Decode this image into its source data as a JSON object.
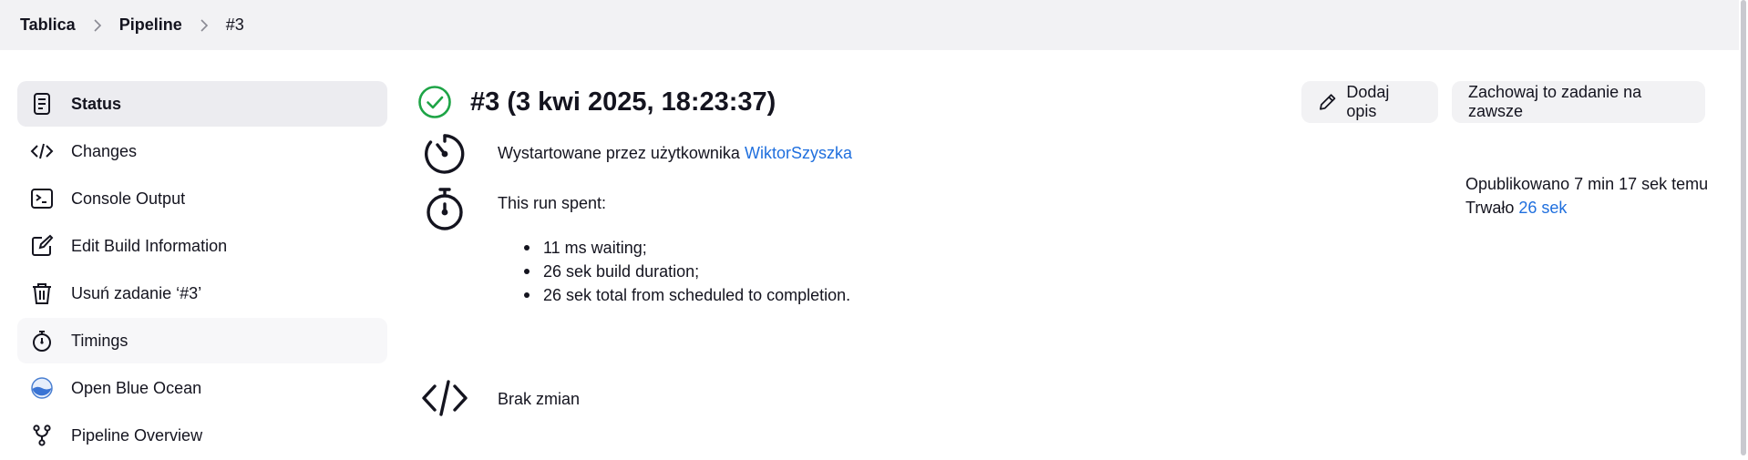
{
  "breadcrumb": {
    "items": [
      "Tablica",
      "Pipeline"
    ],
    "current": "#3"
  },
  "sidebar": {
    "items": [
      {
        "label": "Status",
        "icon": "document-icon"
      },
      {
        "label": "Changes",
        "icon": "code-icon"
      },
      {
        "label": "Console Output",
        "icon": "terminal-icon"
      },
      {
        "label": "Edit Build Information",
        "icon": "edit-icon"
      },
      {
        "label": "Usuń zadanie ‘#3’",
        "icon": "trash-icon"
      },
      {
        "label": "Timings",
        "icon": "stopwatch-icon"
      },
      {
        "label": "Open Blue Ocean",
        "icon": "blue-ocean-icon"
      },
      {
        "label": "Pipeline Overview",
        "icon": "pipeline-graph-icon"
      }
    ]
  },
  "build": {
    "title": "#3 (3 kwi 2025, 18:23:37)",
    "status": "success",
    "add_description_label": "Dodaj opis",
    "keep_forever_label": "Zachowaj to zadanie na zawsze",
    "started_by_prefix": "Wystartowane przez użytkownika",
    "started_by_user": "WiktorSzyszka",
    "spent_title": "This run spent:",
    "spent_items": [
      "11 ms waiting;",
      "26 sek build duration;",
      "26 sek total from scheduled to completion."
    ],
    "changes_text": "Brak zmian",
    "published_text": "Opublikowano 7 min 17 sek temu",
    "duration_prefix": "Trwało",
    "duration_value": "26 sek"
  },
  "colors": {
    "success": "#1ea446",
    "link": "#1f6fde",
    "active_bg": "#ececf0"
  }
}
